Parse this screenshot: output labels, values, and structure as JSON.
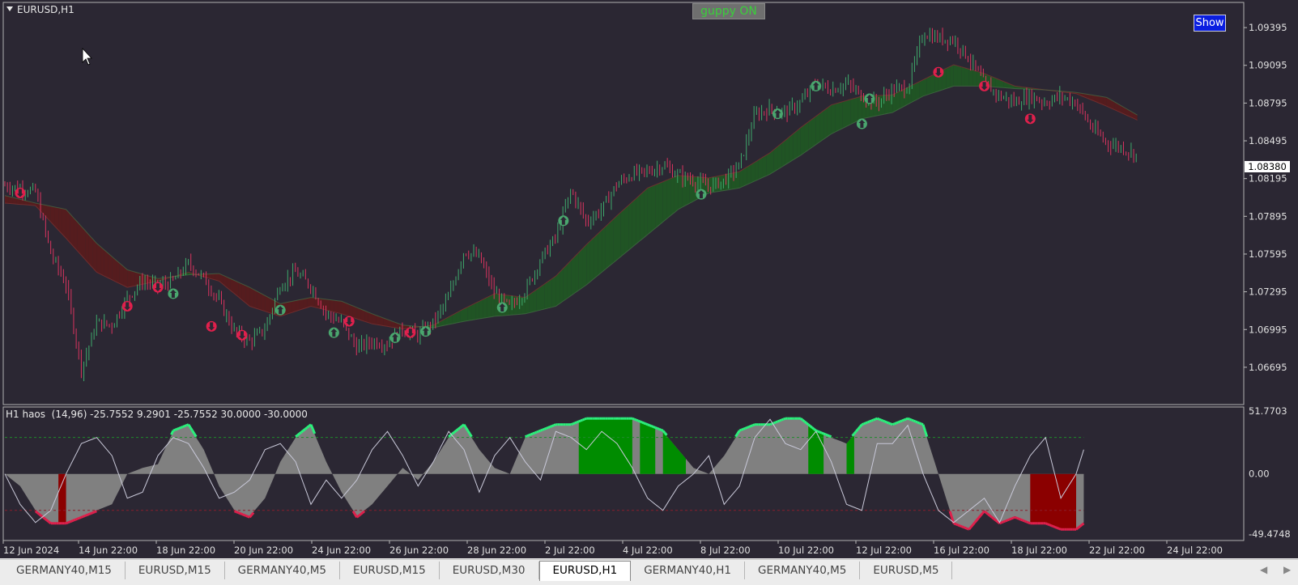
{
  "symbol": "EURUSD,H1",
  "buttons": {
    "guppy": "guppy ON",
    "show": "Show"
  },
  "indicator_label": "H1 haos  (14,96) -25.7552 9.2901 -25.7552 30.0000 -30.0000",
  "current_price": "1.08380",
  "colors": {
    "background": "#2b2733",
    "candle_up": "#3ea86b",
    "candle_down": "#d8345f",
    "ribbon_up": "#1f5a22",
    "ribbon_down": "#5a1c1c",
    "histogram_gray": "#808080",
    "bar_green": "#008c00",
    "bar_red": "#8b0000",
    "line_bright_green": "#2cf07c",
    "line_red": "#e0204c",
    "arrow_green": "#4aa66e",
    "arrow_red": "#e0204c"
  },
  "chart_data": [
    {
      "type": "candlestick",
      "series_name": "EURUSD,H1",
      "ylim": [
        1.0645,
        1.0955
      ],
      "price_ticks": [
        "1.09395",
        "1.09095",
        "1.08795",
        "1.08495",
        "1.08195",
        "1.07895",
        "1.07595",
        "1.07295",
        "1.06995",
        "1.06695"
      ],
      "x_ticks": [
        "12 Jun 2024",
        "14 Jun 22:00",
        "18 Jun 22:00",
        "20 Jun 22:00",
        "24 Jun 22:00",
        "26 Jun 22:00",
        "28 Jun 22:00",
        "2 Jul 22:00",
        "4 Jul 22:00",
        "8 Jul 22:00",
        "10 Jul 22:00",
        "12 Jul 22:00",
        "16 Jul 22:00",
        "18 Jul 22:00",
        "22 Jul 22:00",
        "24 Jul 22:00"
      ],
      "close_path": [
        [
          0,
          1.0814
        ],
        [
          2,
          1.0812
        ],
        [
          4,
          1.0809
        ],
        [
          6,
          1.076
        ],
        [
          8,
          1.0735
        ],
        [
          10,
          1.0668
        ],
        [
          12,
          1.0705
        ],
        [
          14,
          1.0703
        ],
        [
          16,
          1.0725
        ],
        [
          18,
          1.0738
        ],
        [
          20,
          1.0734
        ],
        [
          22,
          1.0738
        ],
        [
          24,
          1.0752
        ],
        [
          26,
          1.074
        ],
        [
          28,
          1.0722
        ],
        [
          30,
          1.0698
        ],
        [
          32,
          1.069
        ],
        [
          34,
          1.07
        ],
        [
          36,
          1.0735
        ],
        [
          38,
          1.0745
        ],
        [
          40,
          1.0734
        ],
        [
          42,
          1.0712
        ],
        [
          44,
          1.0705
        ],
        [
          46,
          1.0685
        ],
        [
          48,
          1.069
        ],
        [
          50,
          1.0688
        ],
        [
          52,
          1.07
        ],
        [
          54,
          1.0695
        ],
        [
          56,
          1.0705
        ],
        [
          58,
          1.0725
        ],
        [
          60,
          1.0762
        ],
        [
          62,
          1.0757
        ],
        [
          64,
          1.0728
        ],
        [
          66,
          1.0717
        ],
        [
          68,
          1.073
        ],
        [
          70,
          1.0755
        ],
        [
          72,
          1.0773
        ],
        [
          74,
          1.081
        ],
        [
          76,
          1.0785
        ],
        [
          78,
          1.0795
        ],
        [
          80,
          1.0815
        ],
        [
          82,
          1.0823
        ],
        [
          84,
          1.0825
        ],
        [
          86,
          1.083
        ],
        [
          88,
          1.0822
        ],
        [
          90,
          1.0818
        ],
        [
          92,
          1.0813
        ],
        [
          94,
          1.0818
        ],
        [
          96,
          1.083
        ],
        [
          98,
          1.087
        ],
        [
          100,
          1.0875
        ],
        [
          102,
          1.0872
        ],
        [
          104,
          1.088
        ],
        [
          106,
          1.0895
        ],
        [
          108,
          1.089
        ],
        [
          110,
          1.0895
        ],
        [
          112,
          1.0885
        ],
        [
          114,
          1.088
        ],
        [
          116,
          1.089
        ],
        [
          118,
          1.0892
        ],
        [
          120,
          1.0935
        ],
        [
          122,
          1.0931
        ],
        [
          124,
          1.093
        ],
        [
          126,
          1.0915
        ],
        [
          128,
          1.0895
        ],
        [
          130,
          1.0885
        ],
        [
          132,
          1.088
        ],
        [
          134,
          1.0885
        ],
        [
          136,
          1.088
        ],
        [
          138,
          1.0885
        ],
        [
          140,
          1.088
        ],
        [
          142,
          1.086
        ],
        [
          144,
          1.0848
        ],
        [
          146,
          1.0844
        ],
        [
          148,
          1.0838
        ]
      ],
      "guppy_fast": [
        [
          0,
          1.08
        ],
        [
          4,
          1.0798
        ],
        [
          8,
          1.0772
        ],
        [
          12,
          1.0745
        ],
        [
          16,
          1.0733
        ],
        [
          20,
          1.0738
        ],
        [
          24,
          1.0745
        ],
        [
          28,
          1.0738
        ],
        [
          32,
          1.0718
        ],
        [
          36,
          1.071
        ],
        [
          40,
          1.0718
        ],
        [
          44,
          1.0712
        ],
        [
          48,
          1.0704
        ],
        [
          52,
          1.07
        ],
        [
          56,
          1.0703
        ],
        [
          60,
          1.0716
        ],
        [
          64,
          1.0728
        ],
        [
          68,
          1.0725
        ],
        [
          72,
          1.0742
        ],
        [
          76,
          1.0767
        ],
        [
          80,
          1.079
        ],
        [
          84,
          1.0812
        ],
        [
          88,
          1.0822
        ],
        [
          92,
          1.082
        ],
        [
          96,
          1.0825
        ],
        [
          100,
          1.084
        ],
        [
          104,
          1.086
        ],
        [
          108,
          1.0878
        ],
        [
          112,
          1.0885
        ],
        [
          116,
          1.0886
        ],
        [
          120,
          1.0898
        ],
        [
          124,
          1.091
        ],
        [
          128,
          1.0903
        ],
        [
          132,
          1.0893
        ],
        [
          136,
          1.089
        ],
        [
          140,
          1.0887
        ],
        [
          144,
          1.0877
        ],
        [
          148,
          1.0866
        ]
      ],
      "guppy_slow": [
        [
          0,
          1.0806
        ],
        [
          4,
          1.08
        ],
        [
          8,
          1.0795
        ],
        [
          12,
          1.0768
        ],
        [
          16,
          1.0747
        ],
        [
          20,
          1.074
        ],
        [
          24,
          1.0743
        ],
        [
          28,
          1.0744
        ],
        [
          32,
          1.0733
        ],
        [
          36,
          1.072
        ],
        [
          40,
          1.0725
        ],
        [
          44,
          1.0722
        ],
        [
          48,
          1.0712
        ],
        [
          52,
          1.0703
        ],
        [
          56,
          1.0701
        ],
        [
          60,
          1.0706
        ],
        [
          64,
          1.071
        ],
        [
          68,
          1.0712
        ],
        [
          72,
          1.0718
        ],
        [
          76,
          1.0735
        ],
        [
          80,
          1.0755
        ],
        [
          84,
          1.0775
        ],
        [
          88,
          1.0795
        ],
        [
          92,
          1.0808
        ],
        [
          96,
          1.0812
        ],
        [
          100,
          1.0823
        ],
        [
          104,
          1.0838
        ],
        [
          108,
          1.0855
        ],
        [
          112,
          1.0867
        ],
        [
          116,
          1.0872
        ],
        [
          120,
          1.0885
        ],
        [
          124,
          1.0893
        ],
        [
          128,
          1.0893
        ],
        [
          132,
          1.0891
        ],
        [
          136,
          1.089
        ],
        [
          140,
          1.0888
        ],
        [
          144,
          1.0884
        ],
        [
          148,
          1.087
        ]
      ],
      "buy_arrows": [
        [
          22,
          1.0728
        ],
        [
          36,
          1.0715
        ],
        [
          43,
          1.0697
        ],
        [
          51,
          1.0693
        ],
        [
          55,
          1.0698
        ],
        [
          65,
          1.0717
        ],
        [
          73,
          1.0786
        ],
        [
          91,
          1.0807
        ],
        [
          101,
          1.0871
        ],
        [
          106,
          1.0893
        ],
        [
          112,
          1.0863
        ],
        [
          113,
          1.0883
        ]
      ],
      "sell_arrows": [
        [
          2,
          1.0808
        ],
        [
          16,
          1.0718
        ],
        [
          20,
          1.0733
        ],
        [
          27,
          1.0702
        ],
        [
          31,
          1.0695
        ],
        [
          45,
          1.0706
        ],
        [
          53,
          1.0697
        ],
        [
          122,
          1.0904
        ],
        [
          128,
          1.0893
        ],
        [
          134,
          1.0867
        ]
      ]
    },
    {
      "type": "histogram",
      "series_name": "H1 haos",
      "ylim": [
        -49.4748,
        51.7703
      ],
      "y_ticks": [
        "51.7703",
        "0.00",
        "-49.4748"
      ],
      "levels": [
        30,
        -30
      ],
      "histogram": [
        [
          0,
          0
        ],
        [
          2,
          -10
        ],
        [
          4,
          -30
        ],
        [
          6,
          -40
        ],
        [
          8,
          -40
        ],
        [
          10,
          -35
        ],
        [
          12,
          -30
        ],
        [
          14,
          -25
        ],
        [
          16,
          0
        ],
        [
          18,
          5
        ],
        [
          20,
          8
        ],
        [
          22,
          35
        ],
        [
          24,
          40
        ],
        [
          26,
          20
        ],
        [
          28,
          -10
        ],
        [
          30,
          -30
        ],
        [
          32,
          -35
        ],
        [
          34,
          -20
        ],
        [
          36,
          10
        ],
        [
          38,
          30
        ],
        [
          40,
          40
        ],
        [
          42,
          10
        ],
        [
          44,
          -15
        ],
        [
          46,
          -35
        ],
        [
          48,
          -25
        ],
        [
          50,
          -10
        ],
        [
          52,
          5
        ],
        [
          54,
          -5
        ],
        [
          56,
          10
        ],
        [
          58,
          30
        ],
        [
          60,
          40
        ],
        [
          62,
          20
        ],
        [
          64,
          5
        ],
        [
          66,
          0
        ],
        [
          68,
          30
        ],
        [
          70,
          35
        ],
        [
          72,
          40
        ],
        [
          74,
          40
        ],
        [
          76,
          45
        ],
        [
          78,
          45
        ],
        [
          80,
          45
        ],
        [
          82,
          45
        ],
        [
          84,
          40
        ],
        [
          86,
          35
        ],
        [
          88,
          20
        ],
        [
          90,
          5
        ],
        [
          92,
          0
        ],
        [
          94,
          15
        ],
        [
          96,
          35
        ],
        [
          98,
          40
        ],
        [
          100,
          40
        ],
        [
          102,
          45
        ],
        [
          104,
          45
        ],
        [
          106,
          35
        ],
        [
          108,
          30
        ],
        [
          110,
          25
        ],
        [
          112,
          40
        ],
        [
          114,
          45
        ],
        [
          116,
          40
        ],
        [
          118,
          45
        ],
        [
          120,
          40
        ],
        [
          122,
          0
        ],
        [
          124,
          -40
        ],
        [
          126,
          -45
        ],
        [
          128,
          -30
        ],
        [
          130,
          -40
        ],
        [
          132,
          -35
        ],
        [
          134,
          -40
        ],
        [
          136,
          -40
        ],
        [
          138,
          -45
        ],
        [
          140,
          -45
        ],
        [
          141,
          -40
        ]
      ],
      "oscillator": [
        [
          0,
          0
        ],
        [
          2,
          -25
        ],
        [
          4,
          -40
        ],
        [
          6,
          -30
        ],
        [
          8,
          0
        ],
        [
          10,
          25
        ],
        [
          12,
          30
        ],
        [
          14,
          15
        ],
        [
          16,
          -20
        ],
        [
          18,
          -15
        ],
        [
          20,
          15
        ],
        [
          22,
          30
        ],
        [
          24,
          25
        ],
        [
          26,
          5
        ],
        [
          28,
          -20
        ],
        [
          30,
          -15
        ],
        [
          32,
          -5
        ],
        [
          34,
          20
        ],
        [
          36,
          25
        ],
        [
          38,
          10
        ],
        [
          40,
          -25
        ],
        [
          42,
          -5
        ],
        [
          44,
          -20
        ],
        [
          46,
          -5
        ],
        [
          48,
          20
        ],
        [
          50,
          35
        ],
        [
          52,
          15
        ],
        [
          54,
          -10
        ],
        [
          56,
          10
        ],
        [
          58,
          35
        ],
        [
          60,
          20
        ],
        [
          62,
          -15
        ],
        [
          64,
          15
        ],
        [
          66,
          30
        ],
        [
          68,
          10
        ],
        [
          70,
          -5
        ],
        [
          72,
          35
        ],
        [
          74,
          30
        ],
        [
          76,
          20
        ],
        [
          78,
          35
        ],
        [
          80,
          25
        ],
        [
          82,
          5
        ],
        [
          84,
          -20
        ],
        [
          86,
          -30
        ],
        [
          88,
          -10
        ],
        [
          90,
          0
        ],
        [
          92,
          15
        ],
        [
          94,
          -25
        ],
        [
          96,
          -10
        ],
        [
          98,
          30
        ],
        [
          100,
          45
        ],
        [
          102,
          25
        ],
        [
          104,
          20
        ],
        [
          106,
          35
        ],
        [
          108,
          10
        ],
        [
          110,
          -25
        ],
        [
          112,
          -30
        ],
        [
          114,
          25
        ],
        [
          116,
          25
        ],
        [
          118,
          40
        ],
        [
          120,
          0
        ],
        [
          122,
          -30
        ],
        [
          124,
          -40
        ],
        [
          126,
          -30
        ],
        [
          128,
          -20
        ],
        [
          130,
          -40
        ],
        [
          132,
          -10
        ],
        [
          134,
          15
        ],
        [
          136,
          30
        ],
        [
          138,
          -20
        ],
        [
          140,
          0
        ],
        [
          141,
          20
        ]
      ],
      "green_bars": [
        [
          75,
          82
        ],
        [
          83,
          85
        ],
        [
          86,
          89
        ],
        [
          105,
          107
        ],
        [
          110,
          111
        ]
      ],
      "red_bars": [
        [
          7,
          8
        ],
        [
          134,
          140
        ]
      ]
    }
  ],
  "tabs": [
    {
      "label": "GERMANY40,M15",
      "active": false
    },
    {
      "label": "EURUSD,M15",
      "active": false
    },
    {
      "label": "GERMANY40,M5",
      "active": false
    },
    {
      "label": "EURUSD,M15",
      "active": false
    },
    {
      "label": "EURUSD,M30",
      "active": false
    },
    {
      "label": "EURUSD,H1",
      "active": true
    },
    {
      "label": "GERMANY40,H1",
      "active": false
    },
    {
      "label": "GERMANY40,M5",
      "active": false
    },
    {
      "label": "EURUSD,M5",
      "active": false
    }
  ]
}
